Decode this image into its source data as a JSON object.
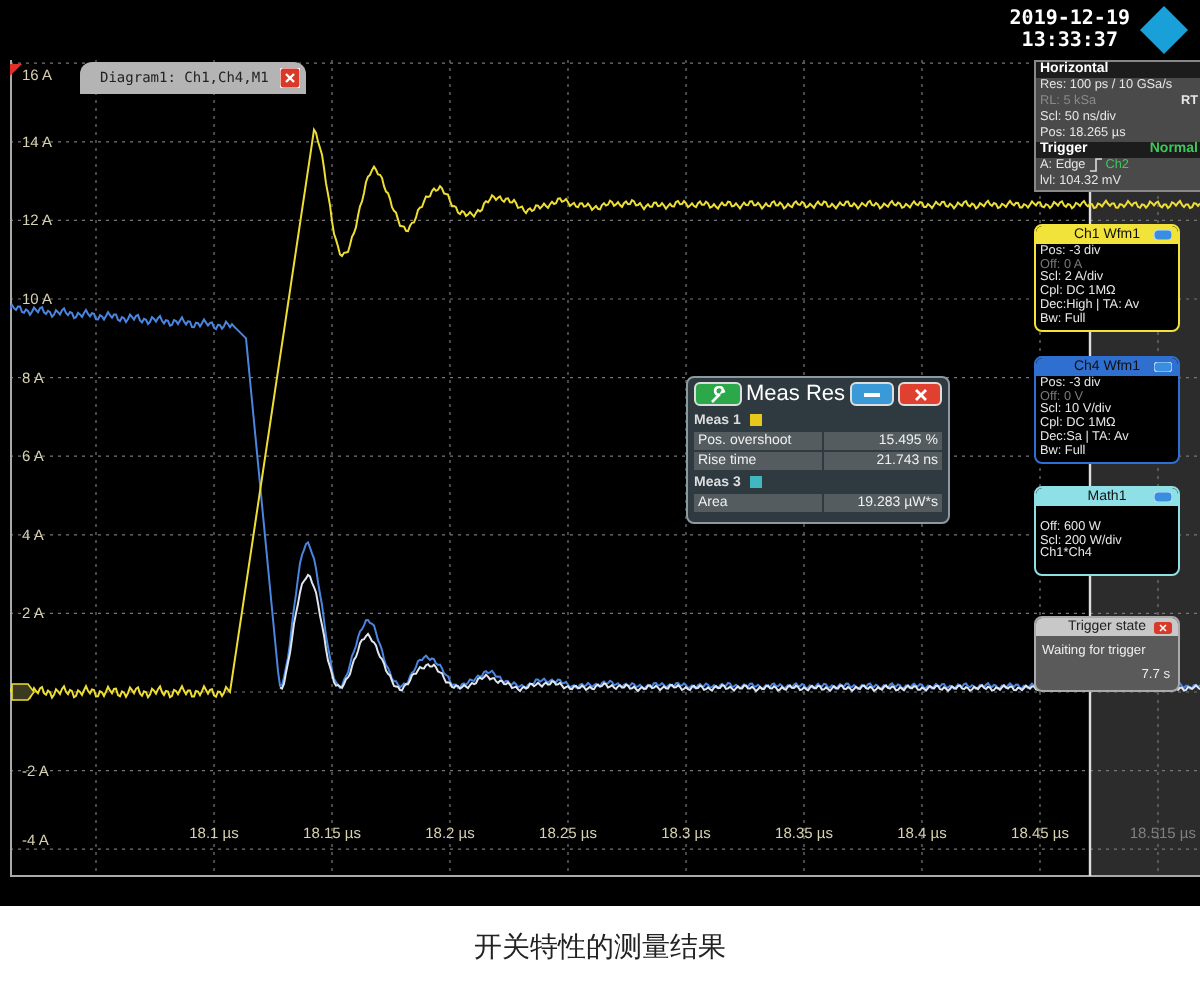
{
  "top_bar": {
    "date": "2019-12-19",
    "time": "13:33:37"
  },
  "diagram_tab": {
    "title": "Diagram1: Ch1,Ch4,M1"
  },
  "y_axis": {
    "labels": [
      "16 A",
      "14 A",
      "12 A",
      "10 A",
      "8 A",
      "6 A",
      "4 A",
      "2 A",
      "-2 A",
      "-4 A"
    ]
  },
  "x_axis": {
    "labels": [
      {
        "text": "18.1 µs",
        "kind": "tick"
      },
      {
        "text": "18.15 µs",
        "kind": "tick"
      },
      {
        "text": "18.2 µs",
        "kind": "tick"
      },
      {
        "text": "18.25 µs",
        "kind": "tick"
      },
      {
        "text": "18.3 µs",
        "kind": "tick"
      },
      {
        "text": "18.35 µs",
        "kind": "tick"
      },
      {
        "text": "18.4 µs",
        "kind": "tick"
      },
      {
        "text": "18.45 µs",
        "kind": "tick"
      },
      {
        "text": "18.515 µs",
        "kind": "end"
      }
    ]
  },
  "horizontal": {
    "title": "Horizontal",
    "lines": [
      {
        "text": "Res: 100 ps / 10 GSa/s",
        "dim": false
      },
      {
        "text": "RL: 5 kSa",
        "dim": true,
        "tag": "RT"
      },
      {
        "text": "Scl: 50 ns/div",
        "dim": false
      },
      {
        "text": "Pos: 18.265 µs",
        "dim": false
      }
    ]
  },
  "trigger": {
    "title": "Trigger",
    "mode": "Normal",
    "edge": "A:  Edge",
    "source": "Ch2",
    "level": "lvl: 104.32 mV"
  },
  "channels": [
    {
      "title": "Ch1 Wfm1",
      "color": "#f2e33a",
      "lines": [
        {
          "text": "Pos: -3 div",
          "dim": false
        },
        {
          "text": "Off: 0 A",
          "dim": true
        },
        {
          "text": "Scl: 2 A/div",
          "dim": false
        },
        {
          "text": "Cpl: DC 1MΩ",
          "dim": false
        },
        {
          "text": "Dec:High | TA: Av",
          "dim": false
        },
        {
          "text": "Bw: Full",
          "dim": false
        }
      ]
    },
    {
      "title": "Ch4 Wfm1",
      "color": "#2f6fd0",
      "lines": [
        {
          "text": "Pos: -3 div",
          "dim": false
        },
        {
          "text": "Off: 0 V",
          "dim": true
        },
        {
          "text": "Scl: 10 V/div",
          "dim": false
        },
        {
          "text": "Cpl: DC 1MΩ",
          "dim": false
        },
        {
          "text": "Dec:Sa | TA: Av",
          "dim": false
        },
        {
          "text": "Bw: Full",
          "dim": false
        }
      ]
    },
    {
      "title": "Math1",
      "color": "#8ee0e6",
      "lines": [
        {
          "text": "Off: 600 W",
          "dim": false
        },
        {
          "text": "Scl: 200 W/div",
          "dim": false
        },
        {
          "text": "Ch1*Ch4",
          "dim": false
        }
      ]
    }
  ],
  "trigger_state": {
    "title": "Trigger state",
    "status": "Waiting for trigger",
    "elapsed": "7.7 s"
  },
  "meas_results": {
    "title": "Meas Res",
    "groups": [
      {
        "label": "Meas 1",
        "color": "#e8c81a",
        "rows": [
          {
            "name": "Pos. overshoot",
            "value": "15.495 %"
          },
          {
            "name": "Rise time",
            "value": "21.743 ns"
          }
        ]
      },
      {
        "label": "Meas 3",
        "color": "#3fb8c0",
        "rows": [
          {
            "name": "Area",
            "value": "19.283 µW*s"
          }
        ]
      }
    ]
  },
  "caption": "开关特性的测量结果"
}
